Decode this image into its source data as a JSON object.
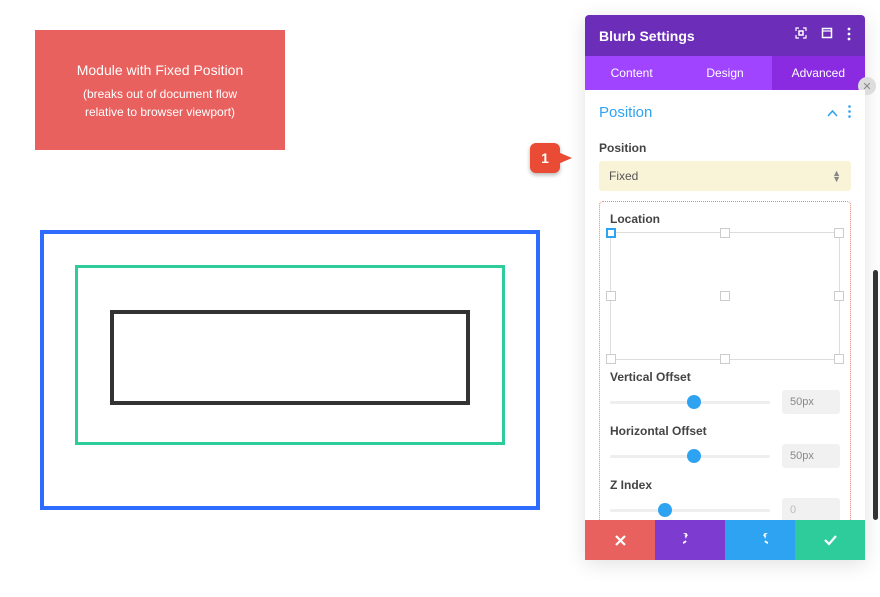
{
  "red_box": {
    "title": "Module with Fixed Position",
    "line1": "(breaks out of document flow",
    "line2": "relative to browser viewport)"
  },
  "callout": {
    "number": "1"
  },
  "panel": {
    "title": "Blurb Settings",
    "tabs": [
      "Content",
      "Design",
      "Advanced"
    ],
    "active_tab": "Advanced",
    "section_title": "Position",
    "position": {
      "label": "Position",
      "value": "Fixed"
    },
    "location": {
      "label": "Location",
      "selected": "top-left"
    },
    "vertical_offset": {
      "label": "Vertical Offset",
      "value": "50px",
      "thumb_pct": 48
    },
    "horizontal_offset": {
      "label": "Horizontal Offset",
      "value": "50px",
      "thumb_pct": 48
    },
    "z_index": {
      "label": "Z Index",
      "value": "0",
      "thumb_pct": 30
    }
  },
  "colors": {
    "accent_blue": "#2ea3f2",
    "purple_dark": "#6c2eb9",
    "purple_mid": "#a044ff",
    "purple_active": "#8a2be2",
    "red": "#e8615e",
    "green": "#2ecc9a"
  }
}
